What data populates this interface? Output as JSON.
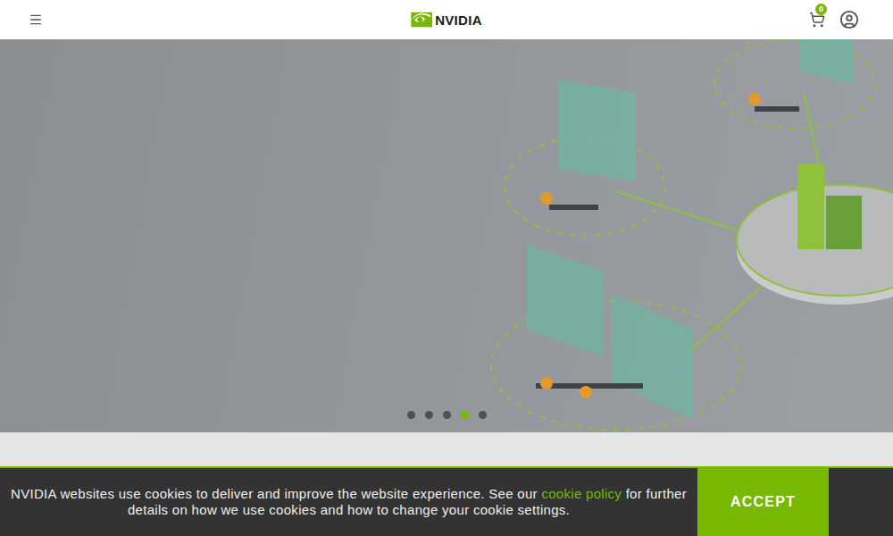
{
  "header": {
    "logo": "NVIDIA",
    "cart_count": "0"
  },
  "hero": {
    "slides": [
      {
        "selected": false
      },
      {
        "selected": false
      },
      {
        "selected": false
      },
      {
        "selected": true
      },
      {
        "selected": false
      }
    ]
  },
  "cookie_banner": {
    "text_before": "NVIDIA websites use cookies to deliver and improve the website experience. See our ",
    "link": "cookie policy",
    "text_after": " for further details on how we use cookies and how to change your cookie settings.",
    "button": "ACCEPT"
  }
}
